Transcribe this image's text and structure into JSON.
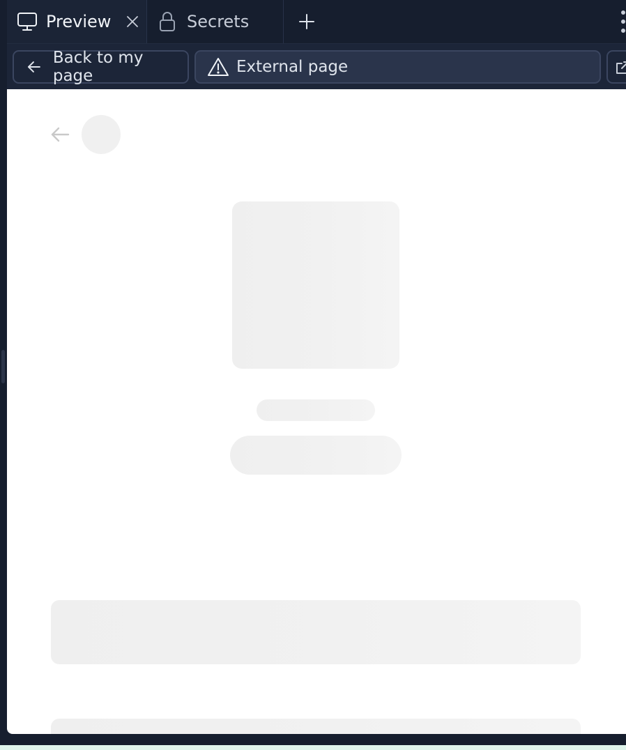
{
  "tabs": [
    {
      "label": "Preview",
      "icon": "monitor-icon",
      "active": true,
      "closable": true
    },
    {
      "label": "Secrets",
      "icon": "lock-icon",
      "active": false,
      "closable": false
    }
  ],
  "tab_actions": {
    "add_icon": "plus-icon",
    "more_icon": "vertical-dots-icon"
  },
  "navbar": {
    "back_label": "Back to my page",
    "back_icon": "arrow-left-icon",
    "external_label": "External page",
    "external_icon": "warning-triangle-icon",
    "open_external_icon": "external-link-icon"
  },
  "preview": {
    "state": "loading-skeleton",
    "back_icon": "arrow-left-icon"
  },
  "colors": {
    "chrome_background": "#161e2e",
    "navbar_background": "#1c2538",
    "field_background": "#2a344b",
    "border": "#3b4660",
    "text": "#dfe4ec",
    "skeleton": "#f0f0f0",
    "page_background": "#ffffff"
  }
}
